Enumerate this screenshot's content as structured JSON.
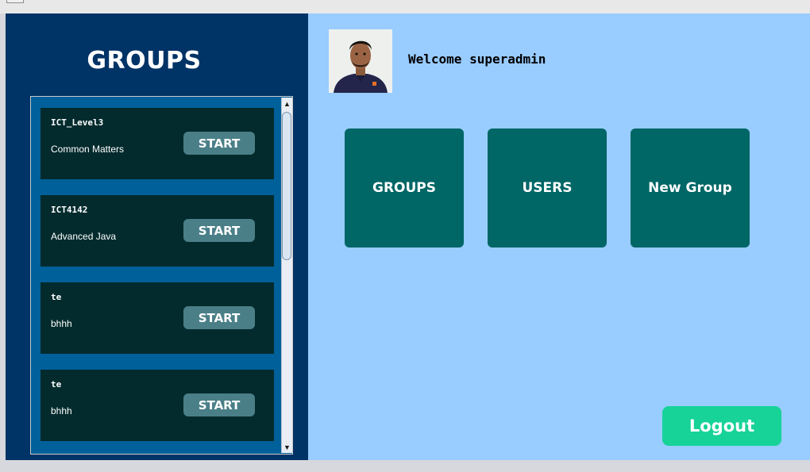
{
  "sidebar": {
    "title": "GROUPS",
    "groups": [
      {
        "code": "ICT_Level3",
        "name": "Common Matters",
        "button": "START"
      },
      {
        "code": "ICT4142",
        "name": "Advanced Java",
        "button": "START"
      },
      {
        "code": "te",
        "name": "bhhh",
        "button": "START"
      },
      {
        "code": "te",
        "name": "bhhh",
        "button": "START"
      }
    ]
  },
  "header": {
    "welcome": "Welcome superadmin",
    "avatar_icon": "user-photo"
  },
  "tiles": [
    {
      "label": "GROUPS"
    },
    {
      "label": "USERS"
    },
    {
      "label": "New Group"
    }
  ],
  "logout_label": "Logout",
  "colors": {
    "sidebar_bg": "#003366",
    "list_bg": "#00609a",
    "card_bg": "#032b2d",
    "start_button": "#4a7f88",
    "main_bg": "#99ccff",
    "tile_bg": "#006666",
    "logout_bg": "#17d398"
  }
}
